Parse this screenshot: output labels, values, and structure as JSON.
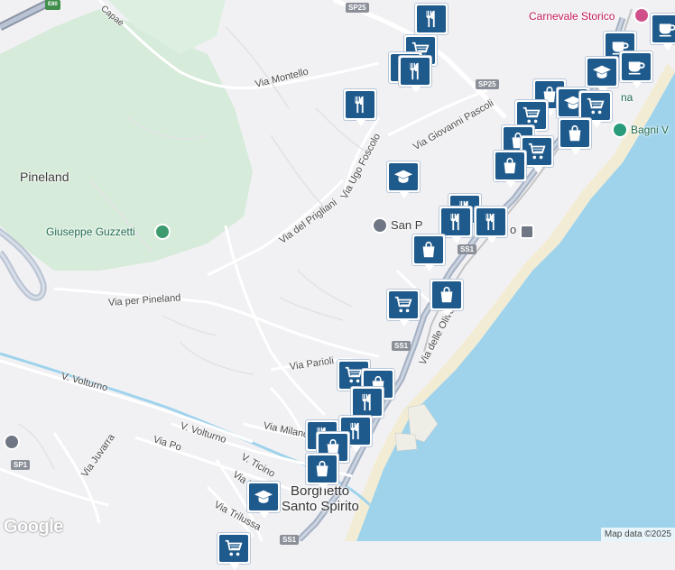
{
  "map": {
    "places": {
      "pineland": "Pineland",
      "giuseppe": "Giuseppe Guzzetti",
      "carnevale": "Carnevale Storico",
      "bagni": "Bagni V",
      "san_pietro": "San P",
      "borghetto_line1": "Borghetto",
      "borghetto_line2": "Santo Spirito",
      "station_fragment": "o",
      "bagni_fragment": "na"
    },
    "streets": {
      "montello": "Via Montello",
      "foscolo": "Via Ugo Foscolo",
      "pascoli": "Via Giovanni Pascoli",
      "prigliani": "Via del Prigliani",
      "pineland_road": "Via per Pineland",
      "parioli": "Via Parioli",
      "volturno1": "V. Volturno",
      "volturno2": "V. Volturno",
      "milano": "Via Milano",
      "po": "Via Po",
      "ticino": "V. Ticino",
      "tevere": "Via Tevere",
      "juvarra": "Via Juvarra",
      "trilussa": "Via Trilussa",
      "olivete": "Via delle Olivete",
      "capae": "Capae"
    },
    "shields": {
      "sp25a": "SP25",
      "sp25b": "SP25",
      "ss1a": "SS1",
      "ss1b": "SS1",
      "ss1c": "SS1",
      "sp1": "SP1",
      "e80": "E80"
    },
    "markers": [
      {
        "type": "restaurant"
      },
      {
        "type": "shopping-cart"
      },
      {
        "type": "restaurant"
      },
      {
        "type": "restaurant"
      },
      {
        "type": "restaurant"
      },
      {
        "type": "school"
      },
      {
        "type": "cafe"
      },
      {
        "type": "cafe"
      },
      {
        "type": "school"
      },
      {
        "type": "shopping-bag"
      },
      {
        "type": "school"
      },
      {
        "type": "shopping-cart"
      },
      {
        "type": "shopping-cart"
      },
      {
        "type": "cafe"
      },
      {
        "type": "shopping-bag"
      },
      {
        "type": "shopping-bag"
      },
      {
        "type": "shopping-cart"
      },
      {
        "type": "shopping-bag"
      },
      {
        "type": "restaurant"
      },
      {
        "type": "restaurant"
      },
      {
        "type": "restaurant"
      },
      {
        "type": "shopping-bag"
      },
      {
        "type": "shopping-bag"
      },
      {
        "type": "shopping-cart"
      },
      {
        "type": "shopping-cart"
      },
      {
        "type": "shopping-bag"
      },
      {
        "type": "restaurant"
      },
      {
        "type": "restaurant"
      },
      {
        "type": "restaurant"
      },
      {
        "type": "shopping-bag"
      },
      {
        "type": "shopping-bag"
      },
      {
        "type": "school"
      },
      {
        "type": "shopping-cart"
      }
    ],
    "colors": {
      "marker": "#1f5a8c",
      "sea": "#9fd3ec",
      "park": "#cde9d3",
      "highway": "#a4b0c3"
    },
    "logo": "Google",
    "attribution": "Map data ©2025"
  }
}
